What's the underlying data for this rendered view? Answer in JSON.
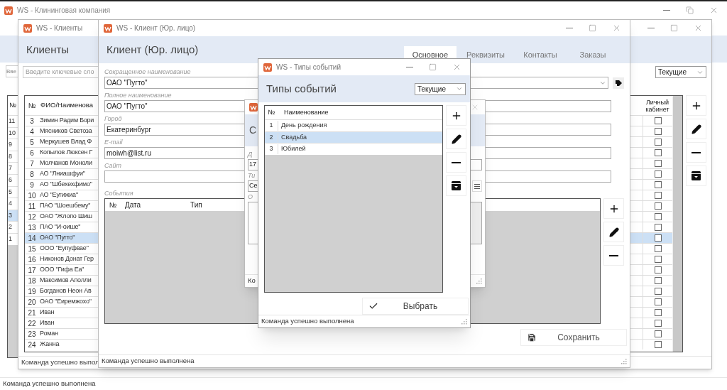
{
  "app": {
    "title": "WS - Клининговая компания",
    "back_search": {
      "placeholder": "Вве"
    },
    "back_table": {
      "column_1": "№",
      "rows": [
        {
          "number": "11",
          "selected": false
        },
        {
          "number": "10",
          "selected": false
        },
        {
          "number": "9",
          "selected": false
        },
        {
          "number": "8",
          "selected": false
        },
        {
          "number": "7",
          "selected": false
        },
        {
          "number": "6",
          "selected": false
        },
        {
          "number": "5",
          "selected": false
        },
        {
          "number": "4",
          "selected": false
        },
        {
          "number": "3",
          "selected": true
        },
        {
          "number": "2",
          "selected": false
        },
        {
          "number": "1",
          "selected": false
        }
      ]
    },
    "status": "Команда успешно выполнена"
  },
  "clients_window": {
    "title": "WS - Клиенты",
    "heading": "Клиенты",
    "search": {
      "placeholder": "Введите ключевые сло"
    },
    "filter": "Текущие",
    "columns": [
      "№",
      "ФИО/Наименова",
      "Личный кабинет"
    ],
    "rows": [
      {
        "number": "3",
        "name": "Зимин Радим Бори",
        "personal_account": false,
        "selected": false
      },
      {
        "number": "4",
        "name": "Мясников Светоза",
        "personal_account": false,
        "selected": false
      },
      {
        "number": "5",
        "name": "Меркушев Влад Ф",
        "personal_account": false,
        "selected": false
      },
      {
        "number": "6",
        "name": "Копылов Люксен Г",
        "personal_account": false,
        "selected": false
      },
      {
        "number": "7",
        "name": "Молчанов Моноли",
        "personal_account": false,
        "selected": false
      },
      {
        "number": "8",
        "name": "АО \"Лниашфуи\"",
        "personal_account": false,
        "selected": false
      },
      {
        "number": "9",
        "name": "АО \"Шбехехфимо\"",
        "personal_account": false,
        "selected": false
      },
      {
        "number": "10",
        "name": "АО \"Еугижиа\"",
        "personal_account": false,
        "selected": false
      },
      {
        "number": "11",
        "name": "ПАО \"Шоешбему\"",
        "personal_account": false,
        "selected": false
      },
      {
        "number": "12",
        "name": "ОАО \"Жлопо Шиш",
        "personal_account": false,
        "selected": false
      },
      {
        "number": "13",
        "name": "ПАО \"И-оише\"",
        "personal_account": false,
        "selected": false
      },
      {
        "number": "14",
        "name": "ОАО \"Пугто\"",
        "personal_account": false,
        "selected": true
      },
      {
        "number": "15",
        "name": "ООО \"Еупуфвае\"",
        "personal_account": false,
        "selected": false
      },
      {
        "number": "16",
        "name": "Никонов Донат Гер",
        "personal_account": false,
        "selected": false
      },
      {
        "number": "17",
        "name": "ООО \"Гифа Еа\"",
        "personal_account": false,
        "selected": false
      },
      {
        "number": "18",
        "name": "Максимов Аполли",
        "personal_account": false,
        "selected": false
      },
      {
        "number": "19",
        "name": "Богданов Неон Ав",
        "personal_account": false,
        "selected": false
      },
      {
        "number": "20",
        "name": "ОАО \"Еиремжохо\"",
        "personal_account": false,
        "selected": false
      },
      {
        "number": "21",
        "name": "Иван",
        "personal_account": false,
        "selected": false
      },
      {
        "number": "22",
        "name": "Иван",
        "personal_account": false,
        "selected": false
      },
      {
        "number": "23",
        "name": "Роман",
        "personal_account": false,
        "selected": false
      },
      {
        "number": "24",
        "name": "Жанна",
        "personal_account": false,
        "selected": false
      }
    ],
    "status": "Команда успешно выпол"
  },
  "client_window": {
    "title": "WS - Клиент (Юр. лицо)",
    "heading": "Клиент (Юр. лицо)",
    "tabs": [
      {
        "label": "Основное",
        "selected": true
      },
      {
        "label": "Реквизиты",
        "selected": false
      },
      {
        "label": "Контакты",
        "selected": false
      },
      {
        "label": "Заказы",
        "selected": false
      }
    ],
    "fields": [
      {
        "label": "Сокращенное наименование",
        "value": "ОАО \"Пугто\"",
        "kind": "select"
      },
      {
        "label": "Полное наименование",
        "value": "ОАО \"Пугто\"",
        "kind": "text"
      },
      {
        "label": "Город",
        "value": "Екатеринбург",
        "kind": "text"
      },
      {
        "label": "E-mail",
        "value": "moiwh@list.ru",
        "kind": "text"
      },
      {
        "label": "Сайт",
        "kind": "text"
      }
    ],
    "events": {
      "label": "События",
      "columns": [
        "№",
        "Дата",
        "Тип"
      ]
    },
    "save_button": "Сохранить",
    "status": "Команда успешно выполнена"
  },
  "event_window": {
    "heading": "С",
    "fields": [
      {
        "label": "Д",
        "value": "17"
      },
      {
        "label": "Ти",
        "value": "Се"
      },
      {
        "label": "О"
      }
    ],
    "status": "Ко"
  },
  "types_window": {
    "title": "WS - Типы событий",
    "heading": "Типы событий",
    "filter": "Текущие",
    "columns": [
      "№",
      "Наименование"
    ],
    "rows": [
      {
        "number": "1",
        "name": "День рождения",
        "selected": false
      },
      {
        "number": "2",
        "name": "Свадьба",
        "selected": true
      },
      {
        "number": "3",
        "name": "Юбилей",
        "selected": false
      }
    ],
    "select_button": "Выбрать",
    "status": "Команда успешно выполнена"
  }
}
